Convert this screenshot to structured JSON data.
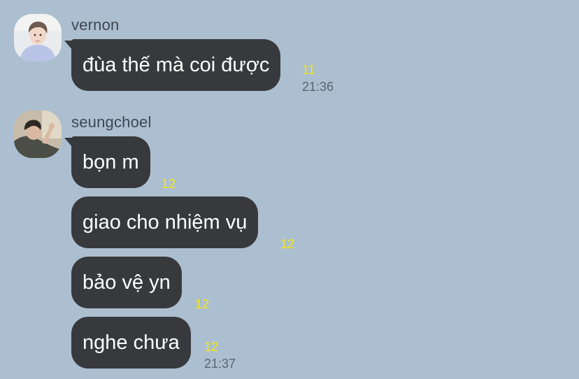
{
  "colors": {
    "background": "#acbfd0",
    "bubble": "#38393c",
    "bubble_text": "#ffffff",
    "unread_count": "#f5e614",
    "timestamp": "#5c6370"
  },
  "groups": [
    {
      "sender": "vernon",
      "avatar_icon": "profile-photo-avatar",
      "messages": [
        {
          "text": "đùa thế mà coi được",
          "unread": "11",
          "time": "21:36"
        }
      ]
    },
    {
      "sender": "seungchoel",
      "avatar_icon": "profile-photo-avatar",
      "messages": [
        {
          "text": "bọn m",
          "unread": "12"
        },
        {
          "text": "giao cho nhiệm vụ",
          "unread": "12"
        },
        {
          "text": "bảo vệ yn",
          "unread": "12"
        },
        {
          "text": "nghe chưa",
          "unread": "12",
          "time": "21:37"
        }
      ]
    }
  ]
}
